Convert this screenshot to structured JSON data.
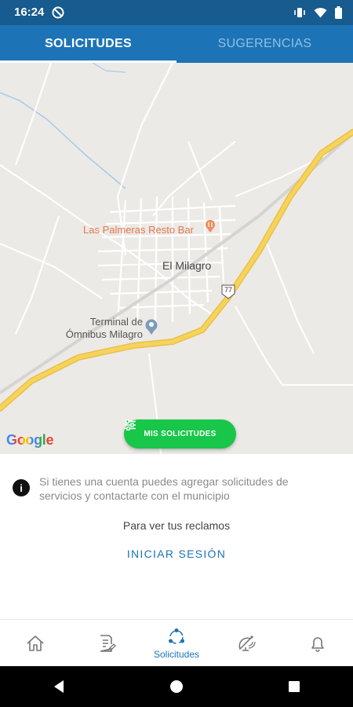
{
  "status_bar": {
    "time": "16:24"
  },
  "tabs": [
    {
      "label": "SOLICITUDES",
      "active": true
    },
    {
      "label": "SUGERENCIAS",
      "active": false
    }
  ],
  "map": {
    "places": {
      "restaurant": "Las Palmeras Resto Bar",
      "town": "El Milagro",
      "terminal_line1": "Terminal de",
      "terminal_line2": "Ómnibus Milagro",
      "route_badge": "77"
    },
    "provider_logo": "Google",
    "mis_solicitudes_label": "MIS SOLICITUDES"
  },
  "info": {
    "message": "Si tienes una cuenta puedes agregar solicitudes de servicios y contactarte con el municipio",
    "reclamos_prompt": "Para ver tus reclamos",
    "login_label": "INICIAR SESIÓN"
  },
  "bottom_nav": {
    "items": [
      {
        "icon": "home-icon",
        "label": ""
      },
      {
        "icon": "edit-document-icon",
        "label": ""
      },
      {
        "icon": "solicitudes-icon",
        "label": "Solicitudes",
        "active": true
      },
      {
        "icon": "satellite-icon",
        "label": ""
      },
      {
        "icon": "bell-icon",
        "label": ""
      }
    ]
  },
  "colors": {
    "primary": "#1c74b6",
    "status_bar": "#175b8f",
    "accent_green": "#18c64a",
    "poi_orange": "#e3764c",
    "road_yellow": "#f6d35b"
  }
}
